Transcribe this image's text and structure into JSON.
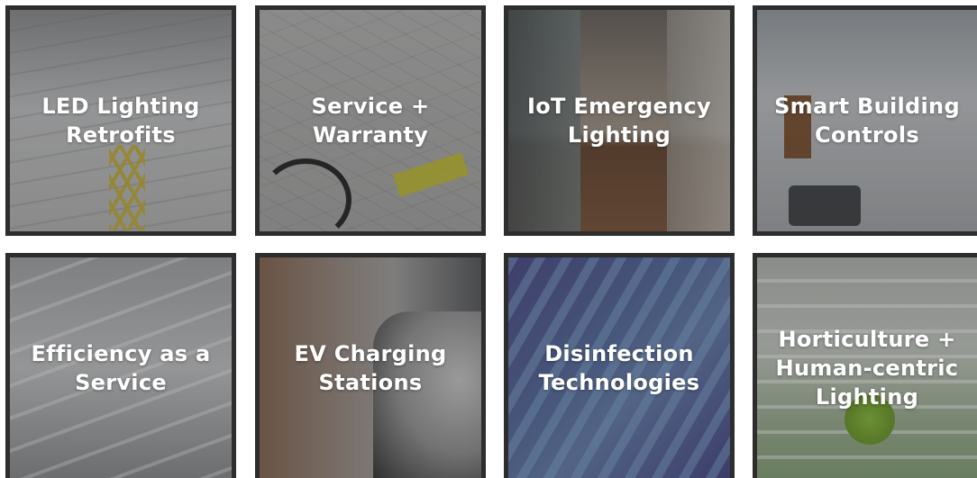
{
  "tiles": [
    {
      "line1": "LED Lighting",
      "line2": "Retrofits"
    },
    {
      "line1": "Service +",
      "line2": "Warranty"
    },
    {
      "line1": "IoT Emergency",
      "line2": "Lighting"
    },
    {
      "line1": "Smart Building",
      "line2": "Controls"
    },
    {
      "line1": "Efficiency as a",
      "line2": "Service"
    },
    {
      "line1": "EV Charging",
      "line2": "Stations"
    },
    {
      "line1": "Disinfection",
      "line2": "Technologies"
    },
    {
      "line1": "Horticulture +",
      "line2": "Human-centric",
      "line3": "Lighting"
    }
  ],
  "colors": {
    "tile_border": "#2d2d2d",
    "label_text": "#ffffff"
  }
}
